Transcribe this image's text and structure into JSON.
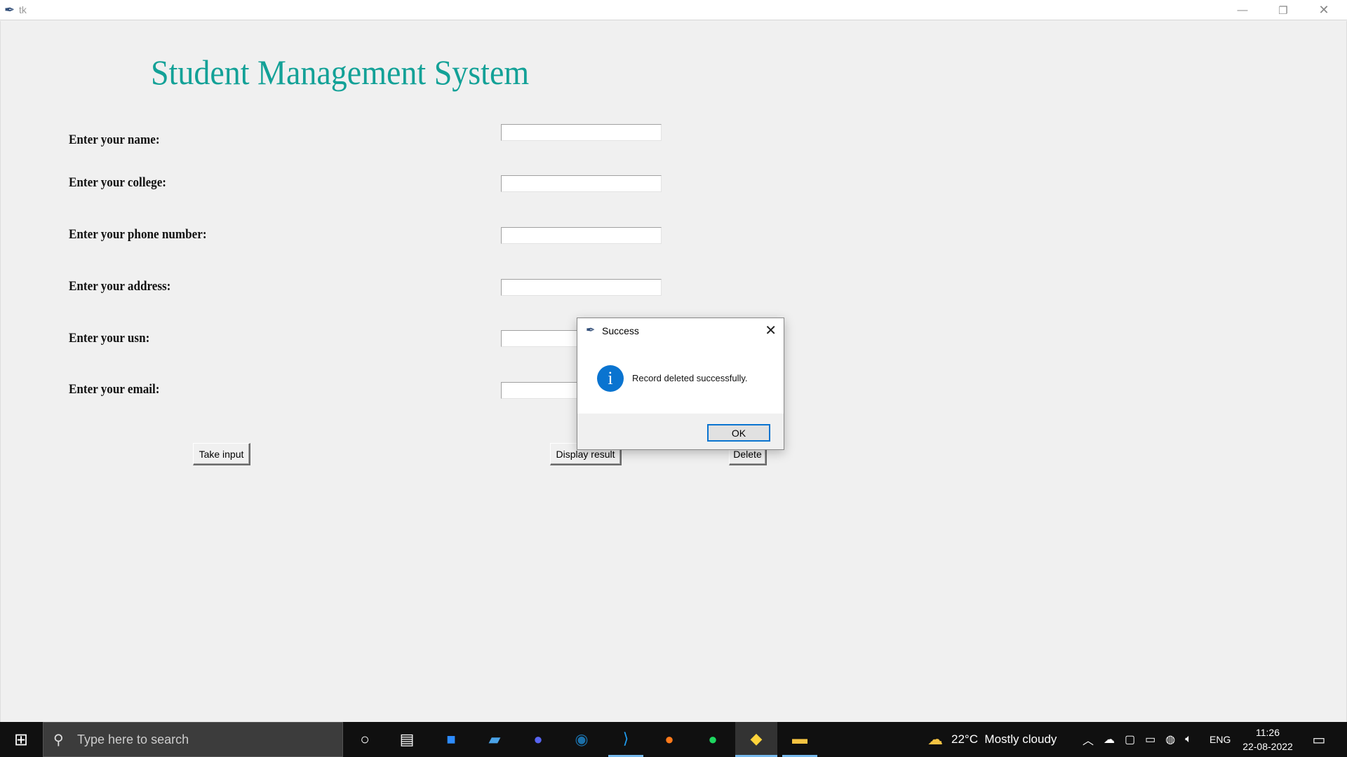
{
  "window": {
    "title": "tk"
  },
  "app": {
    "heading": "Student Management System",
    "fields": [
      {
        "label": "Enter your name:",
        "value": ""
      },
      {
        "label": "Enter your college:",
        "value": ""
      },
      {
        "label": "Enter your phone number:",
        "value": ""
      },
      {
        "label": "Enter your address:",
        "value": ""
      },
      {
        "label": "Enter your usn:",
        "value": ""
      },
      {
        "label": "Enter your email:",
        "value": ""
      }
    ],
    "buttons": {
      "take_input": "Take input",
      "display_result": "Display result",
      "delete": "Delete"
    }
  },
  "dialog": {
    "title": "Success",
    "message": "Record deleted successfully.",
    "ok": "OK"
  },
  "taskbar": {
    "search_placeholder": "Type here to search",
    "weather": "22°C  Mostly cloudy",
    "language": "ENG",
    "time": "11:26",
    "date": "22-08-2022"
  }
}
